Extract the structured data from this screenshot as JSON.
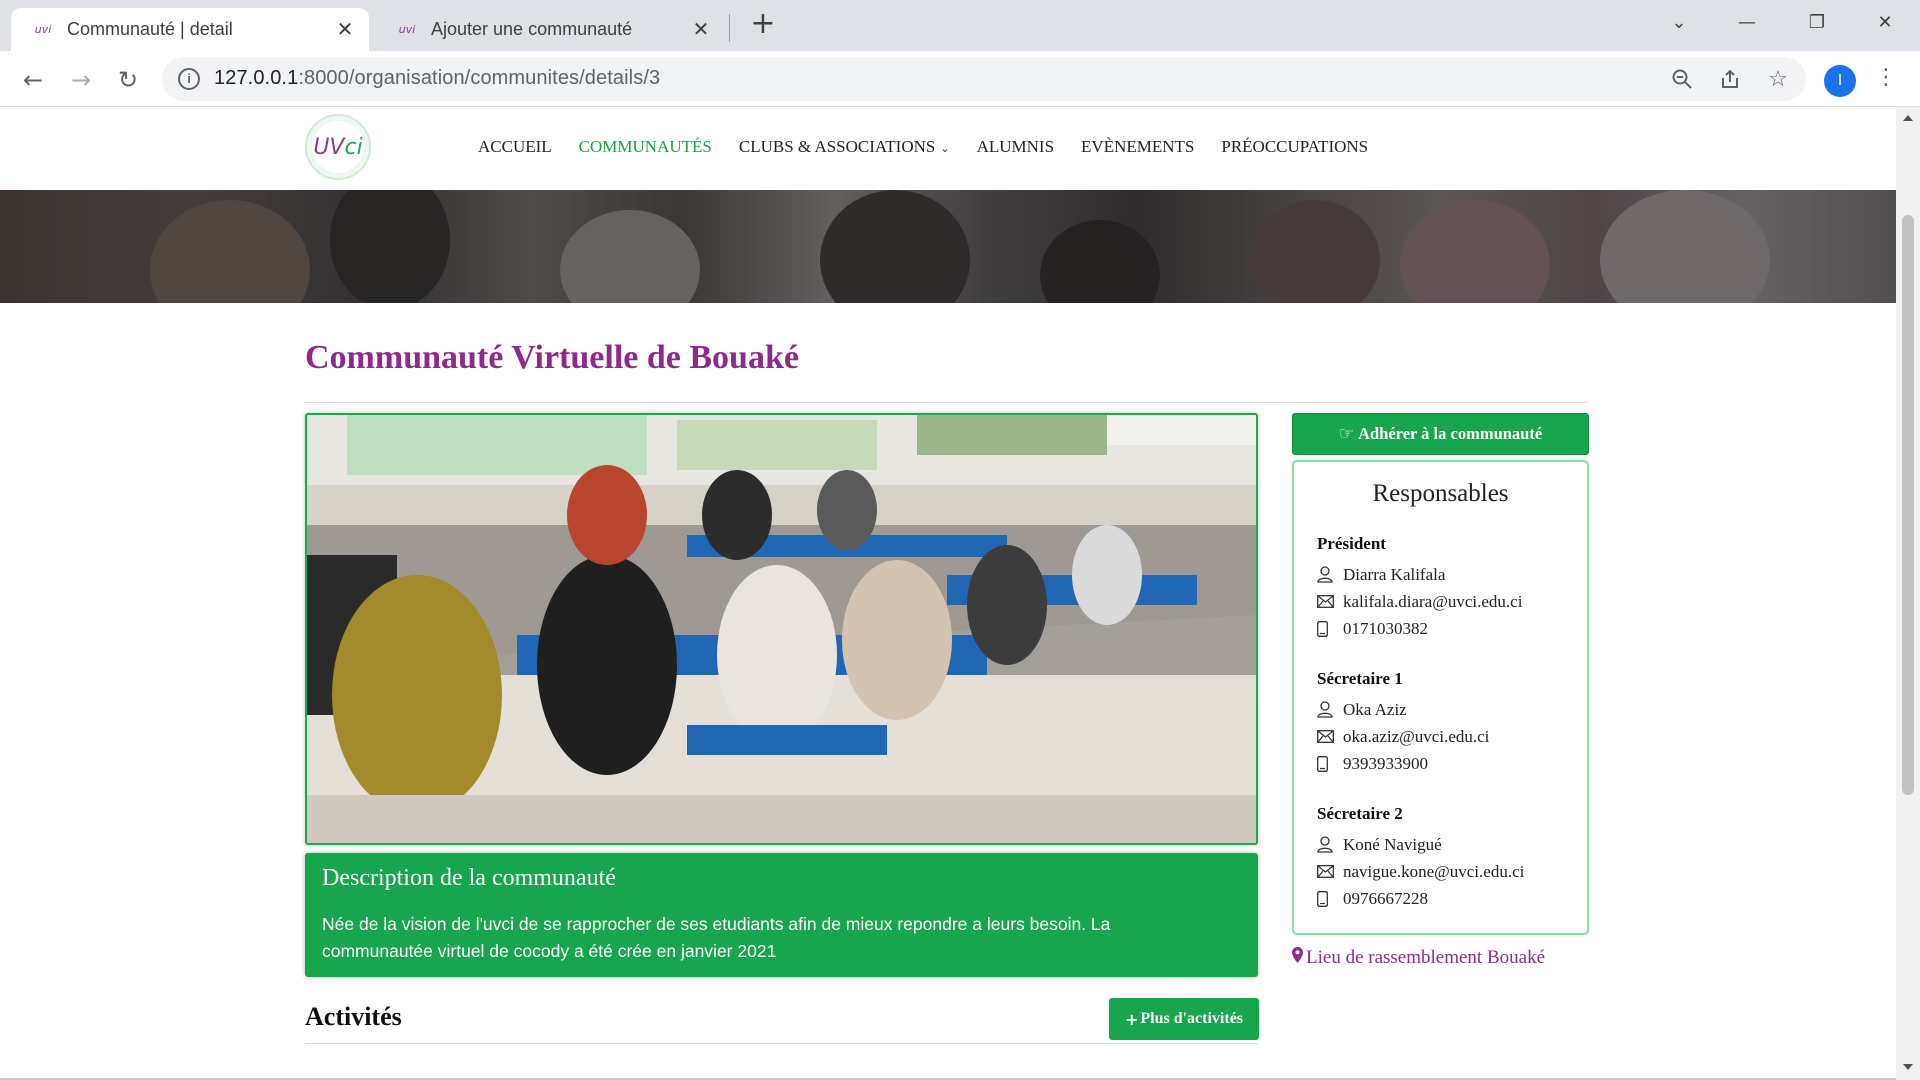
{
  "browser": {
    "tabs": [
      {
        "title": "Communauté | detail",
        "favicon": "uvci-favicon-icon",
        "active": true
      },
      {
        "title": "Ajouter une communauté",
        "favicon": "uvci-favicon-icon",
        "active": false
      }
    ],
    "url_host": "127.0.0.1",
    "url_path": ":8000/organisation/communites/details/3",
    "profile_initial": "I"
  },
  "site": {
    "logo_text": "UVCI",
    "menu": [
      {
        "label": "ACCUEIL",
        "active": false
      },
      {
        "label": "COMMUNAUTÉS",
        "active": true
      },
      {
        "label": "CLUBS & ASSOCIATIONS",
        "active": false,
        "dropdown": true
      },
      {
        "label": "ALUMNIS",
        "active": false
      },
      {
        "label": "EVÈNEMENTS",
        "active": false
      },
      {
        "label": "PRÉOCCUPATIONS",
        "active": false
      }
    ],
    "accent_color": "#18a54d",
    "title_color": "#8e2a8e"
  },
  "community": {
    "title": "Communauté Virtuelle de Bouaké",
    "photo_alt": "classroom-photo",
    "description_title": "Description de la communauté",
    "description_text": "Née de la vision de l'uvci de se rapprocher de ses etudiants afin de mieux repondre a leurs besoin. La communautée virtuel de cocody a été crée en janvier 2021",
    "join_label": "Adhérer à la communauté",
    "responsables_title": "Responsables",
    "responsables": [
      {
        "role": "Président",
        "name": "Diarra Kalifala",
        "email": "kalifala.diara@uvci.edu.ci",
        "phone": "0171030382"
      },
      {
        "role": "Sécretaire 1",
        "name": "Oka Aziz",
        "email": "oka.aziz@uvci.edu.ci",
        "phone": "9393933900"
      },
      {
        "role": "Sécretaire 2",
        "name": "Koné Navigué",
        "email": "navigue.kone@uvci.edu.ci",
        "phone": "0976667228"
      }
    ],
    "rally_label": "Lieu de rassemblement Bouaké",
    "activities_title": "Activités",
    "more_activities_label": "Plus d'activités"
  }
}
